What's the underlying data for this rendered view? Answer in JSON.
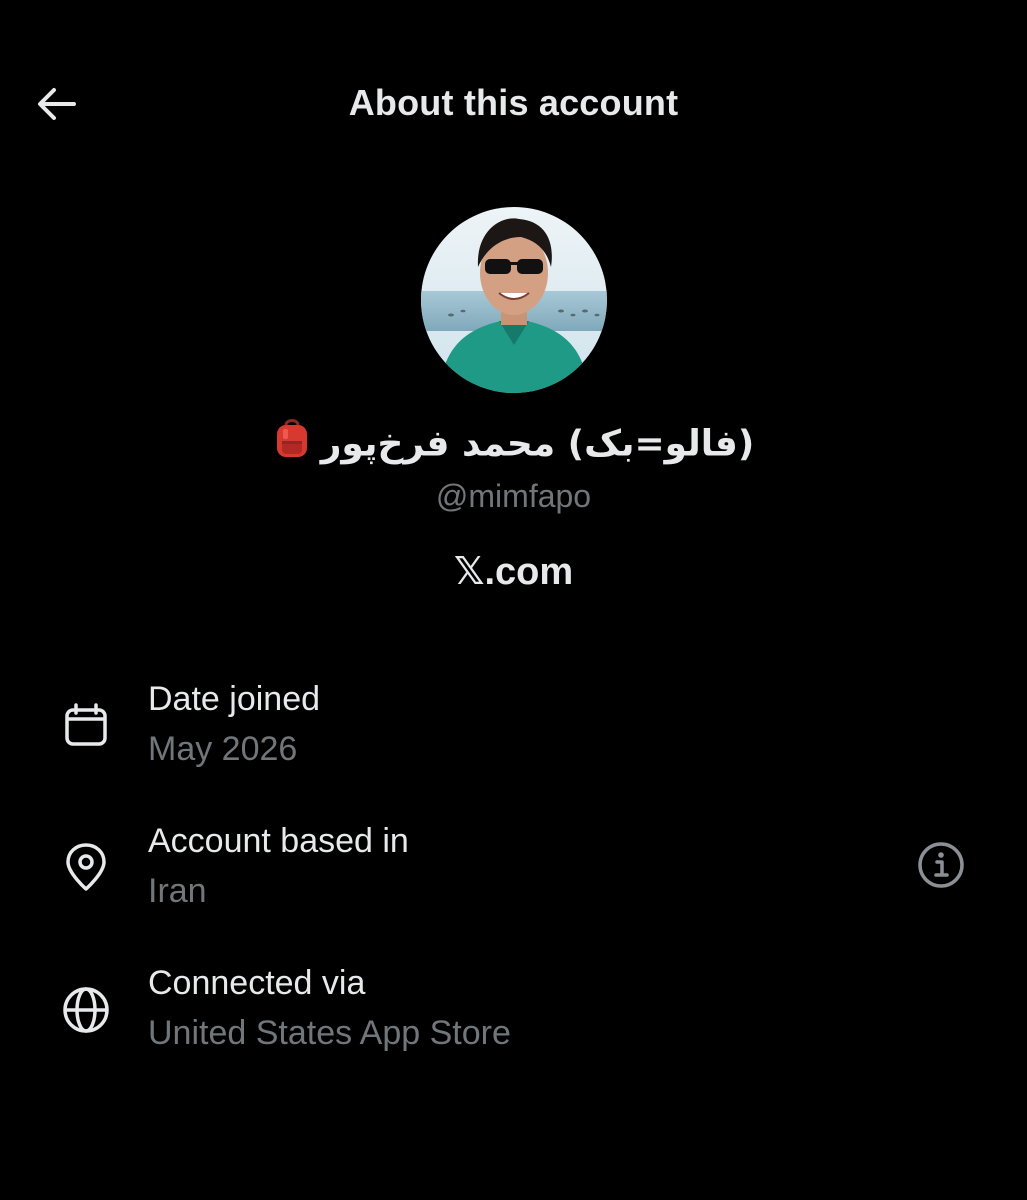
{
  "header": {
    "title": "About this account",
    "back_icon": "arrow-left-icon"
  },
  "profile": {
    "display_name": "(فالو=بک) محمد فرخ‌پور",
    "badge_icon": "backpack-icon",
    "handle": "@mimfapo",
    "website": "𝕏.com"
  },
  "details": [
    {
      "icon": "calendar-icon",
      "label": "Date joined",
      "value": "May 2026"
    },
    {
      "icon": "location-pin-icon",
      "label": "Account based in",
      "value": "Iran",
      "action_icon": "info-icon"
    },
    {
      "icon": "globe-icon",
      "label": "Connected via",
      "value": "United States App Store"
    }
  ],
  "colors": {
    "background": "#000000",
    "primary_text": "#e7e9ea",
    "secondary_text": "#71767b",
    "icon_color": "#e7e9ea",
    "info_icon_color": "#8b9096"
  }
}
